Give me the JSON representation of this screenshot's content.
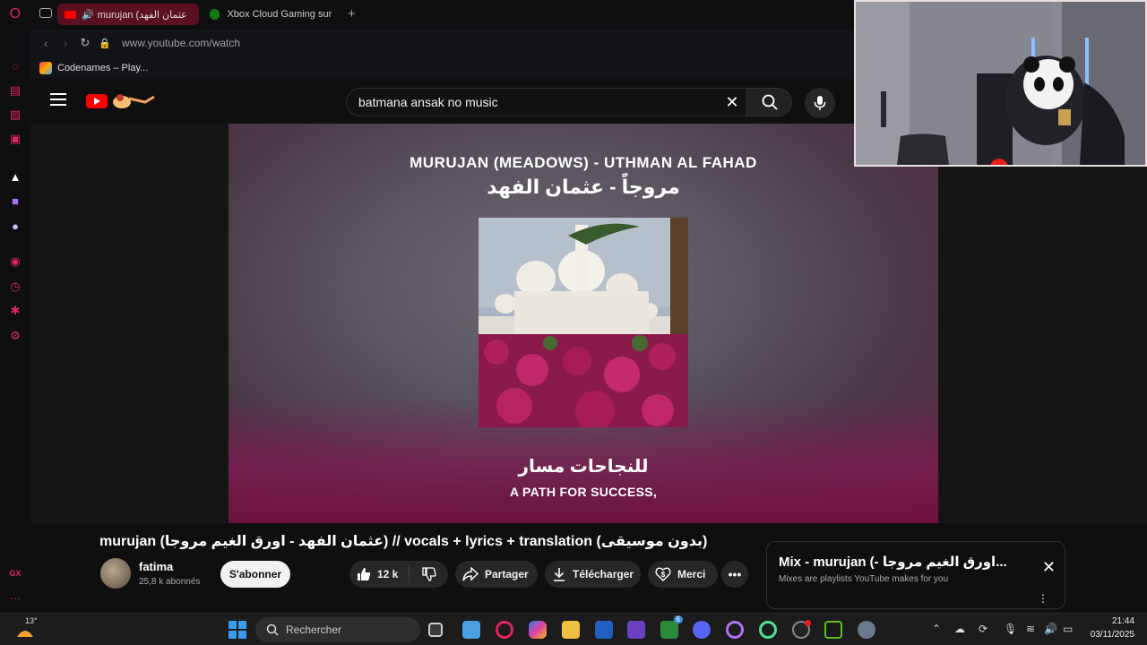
{
  "browser": {
    "tabs": [
      {
        "label": "murujan (عثمان الفهد -"
      },
      {
        "label": "Xbox Cloud Gaming sur X"
      }
    ],
    "url": "www.youtube.com/watch",
    "bookmark": "Codenames – Play..."
  },
  "youtube": {
    "search_query": "batmana ansak no music",
    "player": {
      "title_en": "MURUJAN (MEADOWS) - UTHMAN AL FAHAD",
      "title_ar": "مروجاً - عثمان الفهد",
      "lyric_ar": "للنجاحات مسار",
      "lyric_en": "A PATH FOR SUCCESS,"
    },
    "video_title": "murujan (عثمان الفهد - اورق الغيم مروجا) // vocals + lyrics + translation (بدون موسيقى)",
    "channel": {
      "name": "fatima",
      "subscribers": "25,8 k abonnés"
    },
    "subscribe_label": "S'abonner",
    "actions": {
      "likes": "12 k",
      "share": "Partager",
      "download": "Télécharger",
      "thanks": "Merci"
    },
    "mix": {
      "title": "Mix - murujan (- اورق الغيم مروجا...",
      "subtitle": "Mixes are playlists YouTube makes for you"
    }
  },
  "taskbar": {
    "temperature": "13°",
    "search_placeholder": "Rechercher",
    "time": "21:44",
    "date": "03/11/2025",
    "badge_count": "6"
  },
  "colors": {
    "accent_opera": "#e0245e",
    "youtube_red": "#ff0000"
  }
}
